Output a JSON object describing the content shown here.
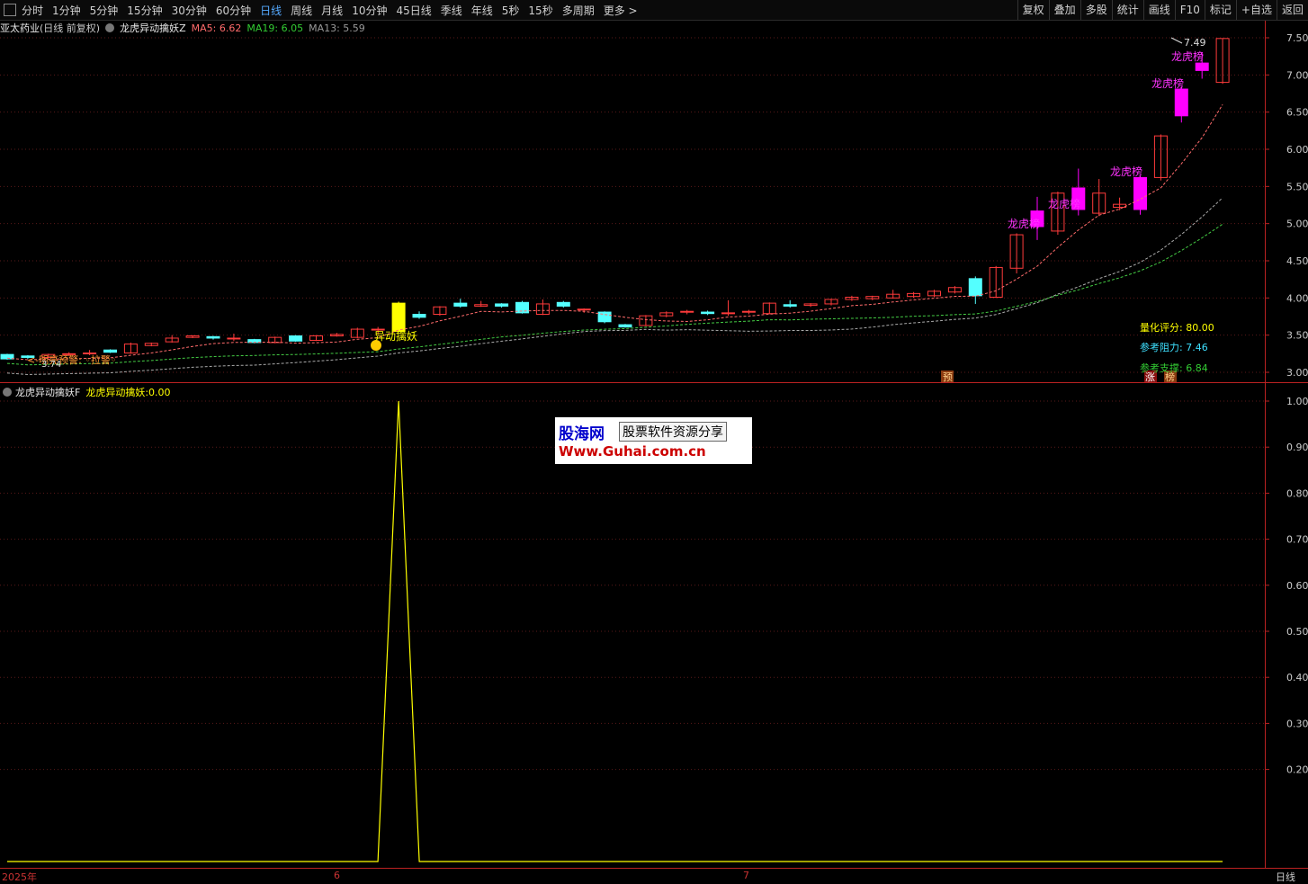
{
  "toolbar": {
    "periods": [
      "分时",
      "1分钟",
      "5分钟",
      "15分钟",
      "30分钟",
      "60分钟",
      "日线",
      "周线",
      "月线",
      "10分钟",
      "45日线",
      "季线",
      "年线",
      "5秒",
      "15秒",
      "多周期",
      "更多 >"
    ],
    "active_period": "日线",
    "right_buttons": [
      "复权",
      "叠加",
      "多股",
      "统计",
      "画线",
      "F10",
      "标记",
      "+自选",
      "返回"
    ]
  },
  "main": {
    "stock_name": "亚太药业",
    "mode": "(日线 前复权)",
    "indicator": "龙虎异动擒妖Z",
    "ma5": "MA5: 6.62",
    "ma19": "MA19: 6.05",
    "ma13": "MA13: 5.59",
    "price_ticks": [
      "7.50",
      "7.00",
      "6.50",
      "6.00",
      "5.50",
      "5.00",
      "4.50",
      "4.00",
      "3.50",
      "3.00"
    ],
    "labels": {
      "yidong": "异动擒妖",
      "long1": "龙虎榜",
      "long2": "龙虎榜",
      "long3": "龙虎榜",
      "long4": "龙虎榜",
      "long5": "龙虎榜",
      "high": "7.49",
      "low_warn": "<-明亮预警: ◦拉警◦",
      "low_val": "3.74",
      "yu": "预",
      "zhang": "涨",
      "bang": "榜"
    },
    "score_label": "量化评分: ",
    "score_value": "80.00",
    "resist_label": "参考阻力: ",
    "resist_value": "7.46",
    "support_label": "参考支撑: ",
    "support_value": "6.84"
  },
  "sub": {
    "indicator": "龙虎异动擒妖F",
    "line_name": "龙虎异动擒妖: ",
    "line_value": "0.00",
    "ticks": [
      "1.00",
      "0.90",
      "0.80",
      "0.70",
      "0.60",
      "0.50",
      "0.40",
      "0.30",
      "0.20"
    ]
  },
  "watermark": {
    "brand": "股海网",
    "slogan": "股票软件资源分享",
    "url": "Www.Guhai.com.cn"
  },
  "bottom": {
    "year": "2025年",
    "m6": "6",
    "m7": "7",
    "period": "日线"
  },
  "chart_data": {
    "type": "candlestick",
    "price_ylim": [
      2.95,
      7.6
    ],
    "candles": [
      {
        "o": 3.18,
        "c": 3.24,
        "h": 3.25,
        "l": 3.17,
        "up": false
      },
      {
        "o": 3.22,
        "c": 3.2,
        "h": 3.23,
        "l": 3.18,
        "up": false
      },
      {
        "o": 3.2,
        "c": 3.24,
        "h": 3.25,
        "l": 3.19,
        "up": true
      },
      {
        "o": 3.24,
        "c": 3.25,
        "h": 3.27,
        "l": 3.22,
        "up": true
      },
      {
        "o": 3.26,
        "c": 3.26,
        "h": 3.3,
        "l": 3.23,
        "up": true
      },
      {
        "o": 3.3,
        "c": 3.27,
        "h": 3.31,
        "l": 3.26,
        "up": false
      },
      {
        "o": 3.26,
        "c": 3.38,
        "h": 3.4,
        "l": 3.25,
        "up": true
      },
      {
        "o": 3.36,
        "c": 3.39,
        "h": 3.4,
        "l": 3.35,
        "up": true
      },
      {
        "o": 3.41,
        "c": 3.46,
        "h": 3.5,
        "l": 3.4,
        "up": true
      },
      {
        "o": 3.47,
        "c": 3.49,
        "h": 3.5,
        "l": 3.46,
        "up": true
      },
      {
        "o": 3.48,
        "c": 3.46,
        "h": 3.49,
        "l": 3.44,
        "up": false
      },
      {
        "o": 3.46,
        "c": 3.46,
        "h": 3.52,
        "l": 3.42,
        "up": true
      },
      {
        "o": 3.44,
        "c": 3.4,
        "h": 3.45,
        "l": 3.39,
        "up": false
      },
      {
        "o": 3.4,
        "c": 3.47,
        "h": 3.48,
        "l": 3.39,
        "up": true
      },
      {
        "o": 3.49,
        "c": 3.42,
        "h": 3.5,
        "l": 3.41,
        "up": false
      },
      {
        "o": 3.43,
        "c": 3.49,
        "h": 3.5,
        "l": 3.42,
        "up": true
      },
      {
        "o": 3.49,
        "c": 3.51,
        "h": 3.53,
        "l": 3.48,
        "up": true
      },
      {
        "o": 3.47,
        "c": 3.58,
        "h": 3.6,
        "l": 3.46,
        "up": true
      },
      {
        "o": 3.58,
        "c": 3.58,
        "h": 3.61,
        "l": 3.51,
        "up": true
      },
      {
        "o": 3.55,
        "c": 3.93,
        "h": 3.95,
        "l": 3.54,
        "up": true,
        "yellow": true
      },
      {
        "o": 3.78,
        "c": 3.74,
        "h": 3.82,
        "l": 3.72,
        "up": false
      },
      {
        "o": 3.78,
        "c": 3.88,
        "h": 3.89,
        "l": 3.76,
        "up": true
      },
      {
        "o": 3.93,
        "c": 3.89,
        "h": 3.99,
        "l": 3.87,
        "up": false
      },
      {
        "o": 3.89,
        "c": 3.91,
        "h": 3.96,
        "l": 3.88,
        "up": true
      },
      {
        "o": 3.92,
        "c": 3.89,
        "h": 3.93,
        "l": 3.87,
        "up": false
      },
      {
        "o": 3.94,
        "c": 3.8,
        "h": 3.96,
        "l": 3.79,
        "up": false
      },
      {
        "o": 3.78,
        "c": 3.92,
        "h": 3.98,
        "l": 3.77,
        "up": true
      },
      {
        "o": 3.94,
        "c": 3.89,
        "h": 3.96,
        "l": 3.87,
        "up": false
      },
      {
        "o": 3.84,
        "c": 3.85,
        "h": 3.86,
        "l": 3.8,
        "up": true
      },
      {
        "o": 3.81,
        "c": 3.68,
        "h": 3.82,
        "l": 3.66,
        "up": false
      },
      {
        "o": 3.64,
        "c": 3.61,
        "h": 3.65,
        "l": 3.6,
        "up": false
      },
      {
        "o": 3.63,
        "c": 3.76,
        "h": 3.77,
        "l": 3.62,
        "up": true
      },
      {
        "o": 3.76,
        "c": 3.8,
        "h": 3.82,
        "l": 3.74,
        "up": true
      },
      {
        "o": 3.82,
        "c": 3.82,
        "h": 3.84,
        "l": 3.78,
        "up": true
      },
      {
        "o": 3.81,
        "c": 3.79,
        "h": 3.83,
        "l": 3.77,
        "up": false
      },
      {
        "o": 3.79,
        "c": 3.8,
        "h": 3.97,
        "l": 3.76,
        "up": true
      },
      {
        "o": 3.82,
        "c": 3.82,
        "h": 3.84,
        "l": 3.78,
        "up": true
      },
      {
        "o": 3.79,
        "c": 3.93,
        "h": 3.94,
        "l": 3.78,
        "up": true
      },
      {
        "o": 3.91,
        "c": 3.89,
        "h": 3.97,
        "l": 3.87,
        "up": false
      },
      {
        "o": 3.9,
        "c": 3.92,
        "h": 3.93,
        "l": 3.88,
        "up": true
      },
      {
        "o": 3.92,
        "c": 3.98,
        "h": 3.99,
        "l": 3.9,
        "up": true
      },
      {
        "o": 3.98,
        "c": 4.01,
        "h": 4.03,
        "l": 3.96,
        "up": true
      },
      {
        "o": 3.99,
        "c": 4.02,
        "h": 4.03,
        "l": 3.97,
        "up": true
      },
      {
        "o": 4.0,
        "c": 4.05,
        "h": 4.11,
        "l": 3.99,
        "up": true
      },
      {
        "o": 4.02,
        "c": 4.06,
        "h": 4.08,
        "l": 4.0,
        "up": true
      },
      {
        "o": 4.03,
        "c": 4.09,
        "h": 4.11,
        "l": 4.01,
        "up": true
      },
      {
        "o": 4.08,
        "c": 4.14,
        "h": 4.16,
        "l": 4.06,
        "up": true
      },
      {
        "o": 4.26,
        "c": 4.03,
        "h": 4.29,
        "l": 3.92,
        "up": false
      },
      {
        "o": 4.01,
        "c": 4.41,
        "h": 4.43,
        "l": 4.0,
        "up": true
      },
      {
        "o": 4.4,
        "c": 4.85,
        "h": 4.87,
        "l": 4.33,
        "up": true
      },
      {
        "o": 5.17,
        "c": 4.96,
        "h": 5.36,
        "l": 4.78,
        "up": false,
        "mag": true
      },
      {
        "o": 4.9,
        "c": 5.41,
        "h": 5.43,
        "l": 4.85,
        "up": true
      },
      {
        "o": 5.48,
        "c": 5.19,
        "h": 5.74,
        "l": 5.11,
        "up": false,
        "mag": true
      },
      {
        "o": 5.14,
        "c": 5.41,
        "h": 5.6,
        "l": 5.1,
        "up": true
      },
      {
        "o": 5.22,
        "c": 5.26,
        "h": 5.35,
        "l": 5.18,
        "up": true
      },
      {
        "o": 5.19,
        "c": 5.62,
        "h": 5.64,
        "l": 5.12,
        "up": true,
        "mag": true
      },
      {
        "o": 5.62,
        "c": 6.18,
        "h": 6.2,
        "l": 5.58,
        "up": true
      },
      {
        "o": 6.45,
        "c": 6.81,
        "h": 6.84,
        "l": 6.36,
        "up": true,
        "mag": true
      },
      {
        "o": 7.06,
        "c": 7.16,
        "h": 7.3,
        "l": 6.95,
        "up": true,
        "mag": true
      },
      {
        "o": 6.9,
        "c": 7.49,
        "h": 7.49,
        "l": 6.88,
        "up": true
      }
    ],
    "sub_series": {
      "name": "龙虎异动擒妖",
      "peak_index": 19,
      "peak_value": 1.0,
      "ylim": [
        0,
        1.02
      ]
    }
  }
}
